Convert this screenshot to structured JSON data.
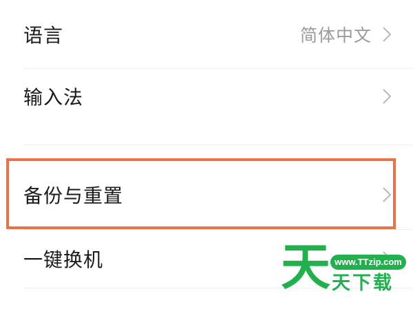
{
  "settings": {
    "items": [
      {
        "label": "语言",
        "value": "简体中文"
      },
      {
        "label": "输入法",
        "value": ""
      },
      {
        "label": "备份与重置",
        "value": ""
      },
      {
        "label": "一键换机",
        "value": ""
      }
    ]
  },
  "highlight": {
    "target": "备份与重置",
    "color": "#e8734a"
  },
  "watermark": {
    "big_char": "天",
    "site": "www.TTzip.com",
    "name": "天下载",
    "color": "#22b04e"
  }
}
